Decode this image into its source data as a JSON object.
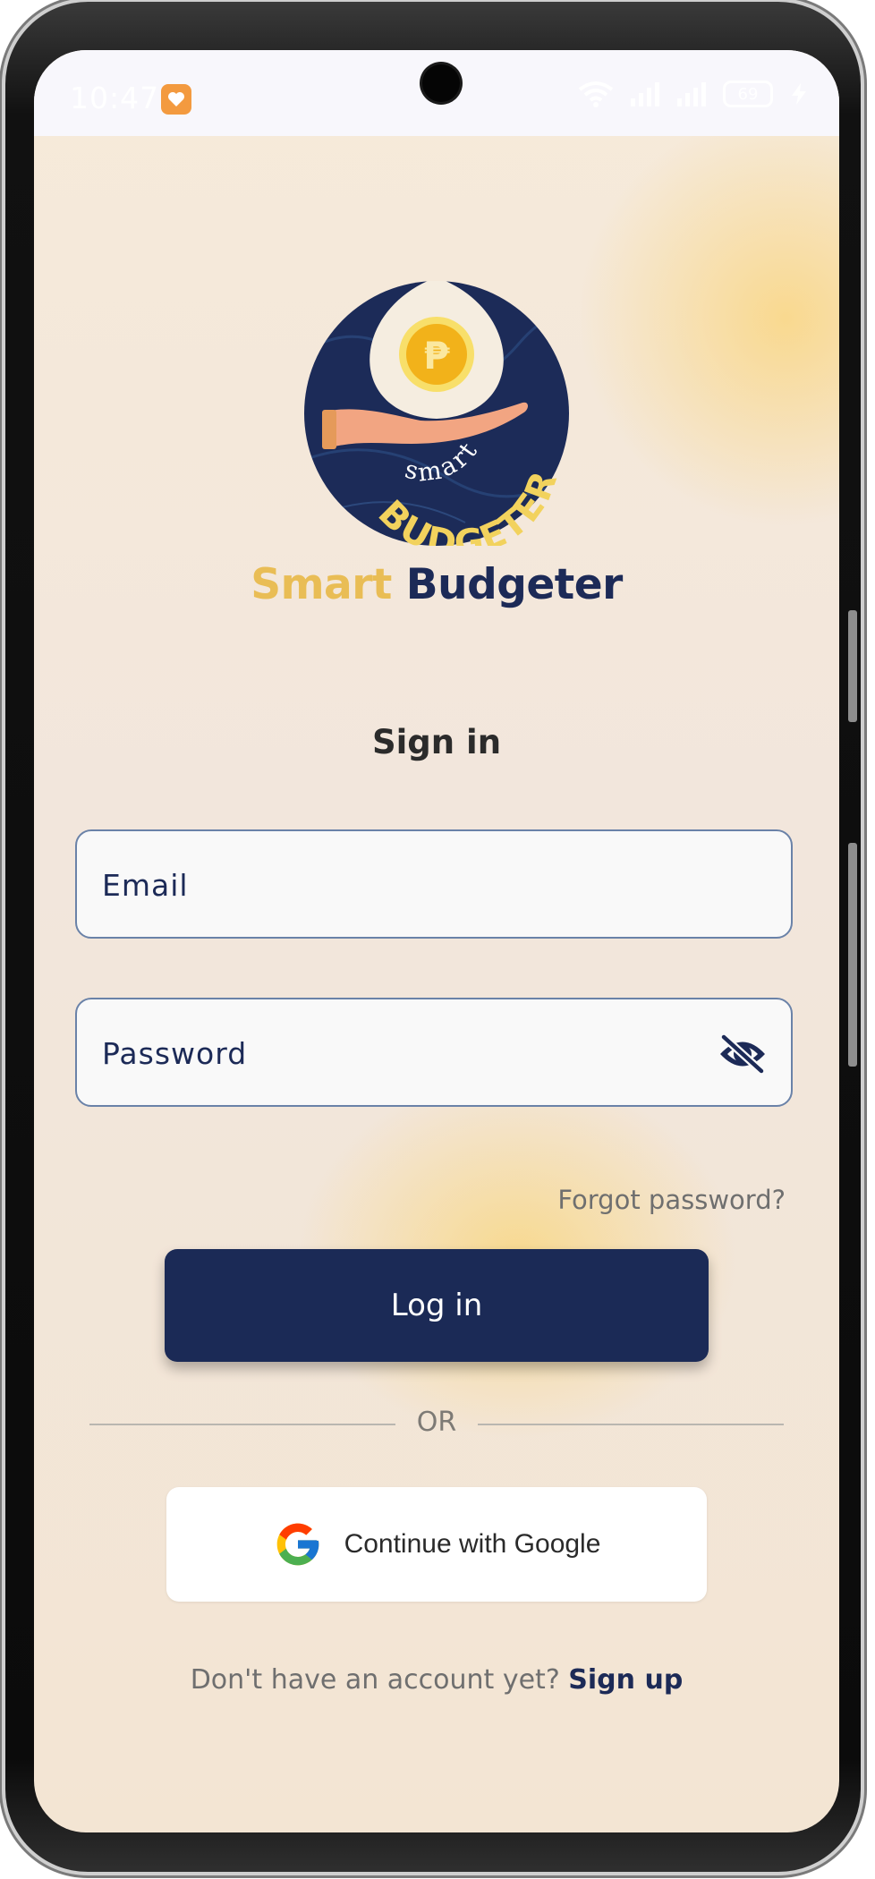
{
  "status_bar": {
    "time": "10:47",
    "battery": "69"
  },
  "logo": {
    "word_top": "smart",
    "word_bottom": "BUDGETER",
    "coin_symbol": "₱",
    "icon": "hand-holding-coin-icon"
  },
  "app_name": {
    "part1": "Smart",
    "part2": "Budgeter",
    "part1_color": "#e9bd55",
    "part2_color": "#1c2a57"
  },
  "heading": "Sign in",
  "email_field": {
    "placeholder": "Email",
    "value": ""
  },
  "password_field": {
    "placeholder": "Password",
    "value": "",
    "toggle_icon": "eye-off-icon"
  },
  "forgot_password": "Forgot password?",
  "login_button": "Log in",
  "divider_text": "OR",
  "google_button": {
    "label": "Continue with Google",
    "icon": "google-icon"
  },
  "signup": {
    "prompt": "Don't have an account yet?",
    "link": "Sign up"
  },
  "colors": {
    "primary": "#1b2a56",
    "accent": "#e9bd55",
    "field_border": "#6a82a8"
  }
}
